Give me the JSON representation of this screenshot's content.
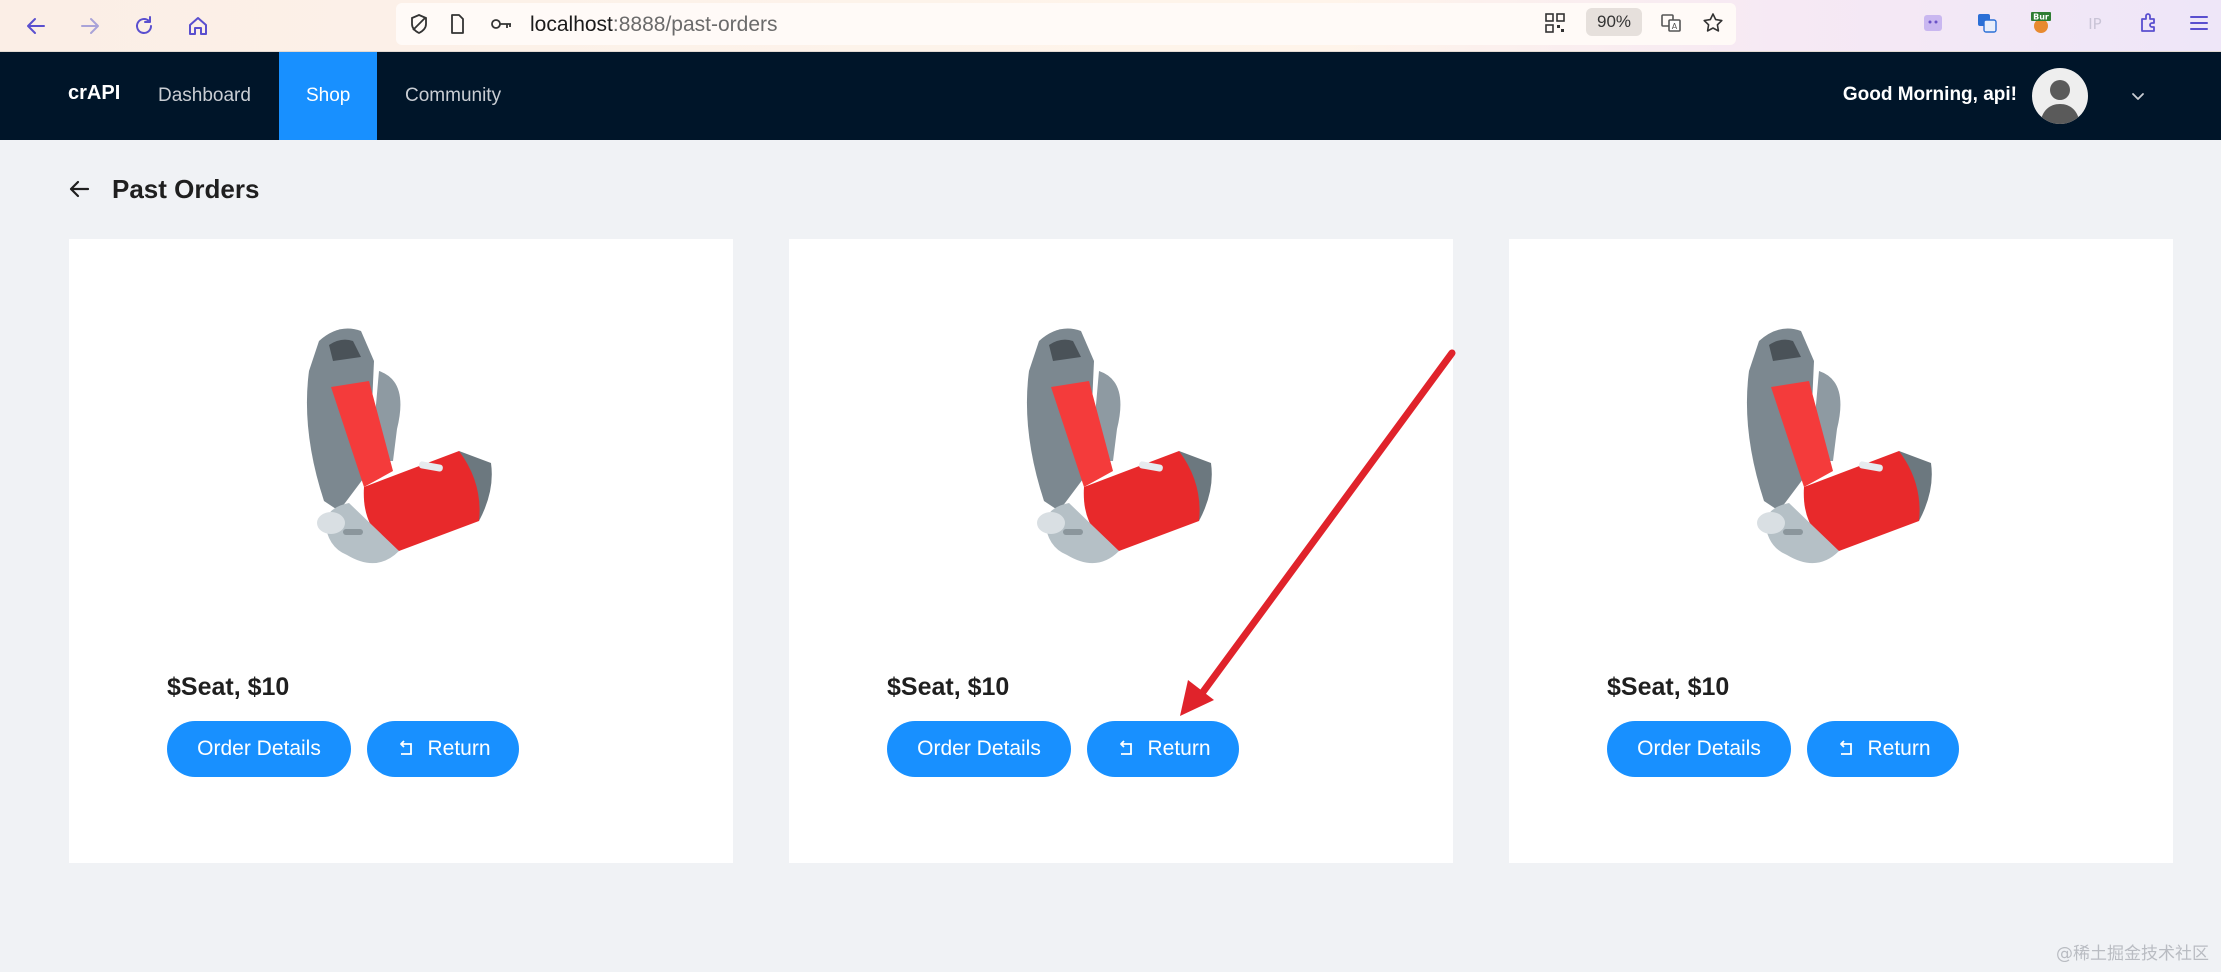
{
  "browser": {
    "url_host": "localhost",
    "url_path": ":8888/past-orders",
    "zoom": "90%",
    "extension_badge": "Bur",
    "ip_label": "IP"
  },
  "header": {
    "brand": "crAPI",
    "nav": [
      {
        "label": "Dashboard",
        "active": false
      },
      {
        "label": "Shop",
        "active": true
      },
      {
        "label": "Community",
        "active": false
      }
    ],
    "greeting": "Good Morning, api!"
  },
  "page": {
    "title": "Past Orders"
  },
  "orders": [
    {
      "price_label": "$Seat, $10",
      "details_label": "Order Details",
      "return_label": "Return"
    },
    {
      "price_label": "$Seat, $10",
      "details_label": "Order Details",
      "return_label": "Return"
    },
    {
      "price_label": "$Seat, $10",
      "details_label": "Order Details",
      "return_label": "Return"
    }
  ],
  "watermark": "@稀土掘金技术社区",
  "colors": {
    "header_bg": "#001529",
    "accent": "#1890ff",
    "page_bg": "#f0f2f5",
    "annotation_arrow": "#e0232b"
  }
}
